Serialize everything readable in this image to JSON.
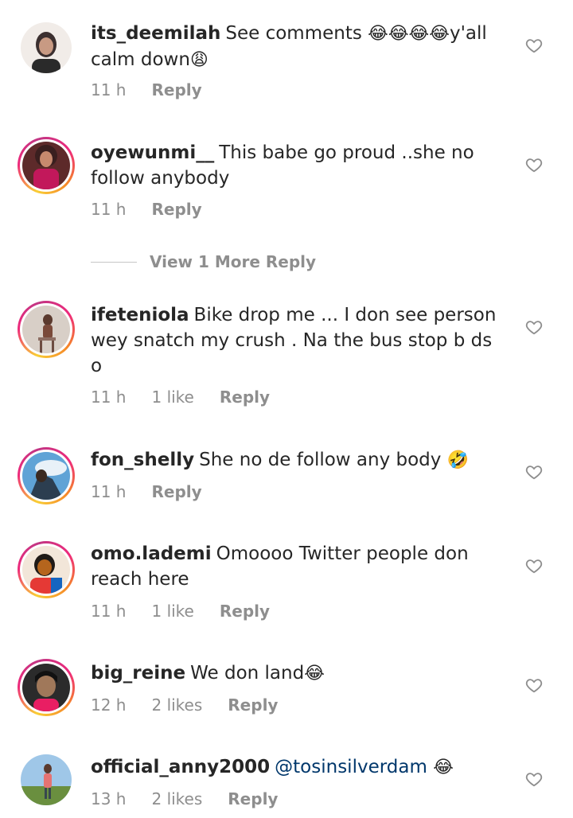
{
  "comments": [
    {
      "username": "its_deemilah",
      "text": "See comments",
      "emoji_after": "😂😂😂😂",
      "text2": "y'all calm down",
      "emoji_end": "😩",
      "time": "11 h",
      "likes": "",
      "reply_label": "Reply",
      "ring": false,
      "avatar_colors": [
        "#f1ece8",
        "#3b2f2f"
      ]
    },
    {
      "username": "oyewunmi__",
      "text": "This babe go proud ..she no follow anybody",
      "time": "11 h",
      "likes": "",
      "reply_label": "Reply",
      "ring": true,
      "avatar_colors": [
        "#c2185b",
        "#5d2a2a"
      ]
    },
    {
      "username": "ifeteniola",
      "text": "Bike drop me ... I don see person wey snatch my crush . Na the bus stop b ds o",
      "time": "11 h",
      "likes": "1 like",
      "reply_label": "Reply",
      "ring": true,
      "avatar_colors": [
        "#d8cfc7",
        "#5b3a2e"
      ]
    },
    {
      "username": "fon_shelly",
      "text": "She no de follow any body",
      "emoji_end": "🤣",
      "time": "11 h",
      "likes": "",
      "reply_label": "Reply",
      "ring": true,
      "avatar_colors": [
        "#5fa3d6",
        "#2c3e50"
      ]
    },
    {
      "username": "omo.lademi",
      "text": "Omoooo Twitter people don reach here",
      "time": "11 h",
      "likes": "1 like",
      "reply_label": "Reply",
      "ring": true,
      "avatar_colors": [
        "#b5651d",
        "#1f1a17"
      ]
    },
    {
      "username": "big_reine",
      "text": "We don land",
      "emoji_end": "😂",
      "time": "12 h",
      "likes": "2 likes",
      "reply_label": "Reply",
      "ring": true,
      "avatar_colors": [
        "#2b2b2b",
        "#a0785a"
      ]
    },
    {
      "username": "official_anny2000",
      "text": "",
      "mention": "@tosinsilverdam",
      "emoji_end": "😂",
      "time": "13 h",
      "likes": "2 likes",
      "reply_label": "Reply",
      "ring": false,
      "avatar_colors": [
        "#9fc7e8",
        "#6a8f3f"
      ]
    }
  ],
  "view_more_label": "View 1 More Reply",
  "colors": {
    "text": "#262626",
    "meta": "#8e8e8e",
    "mention": "#00376b",
    "heart": "#8e8e8e"
  },
  "icons": {
    "like": "heart-outline-icon"
  }
}
